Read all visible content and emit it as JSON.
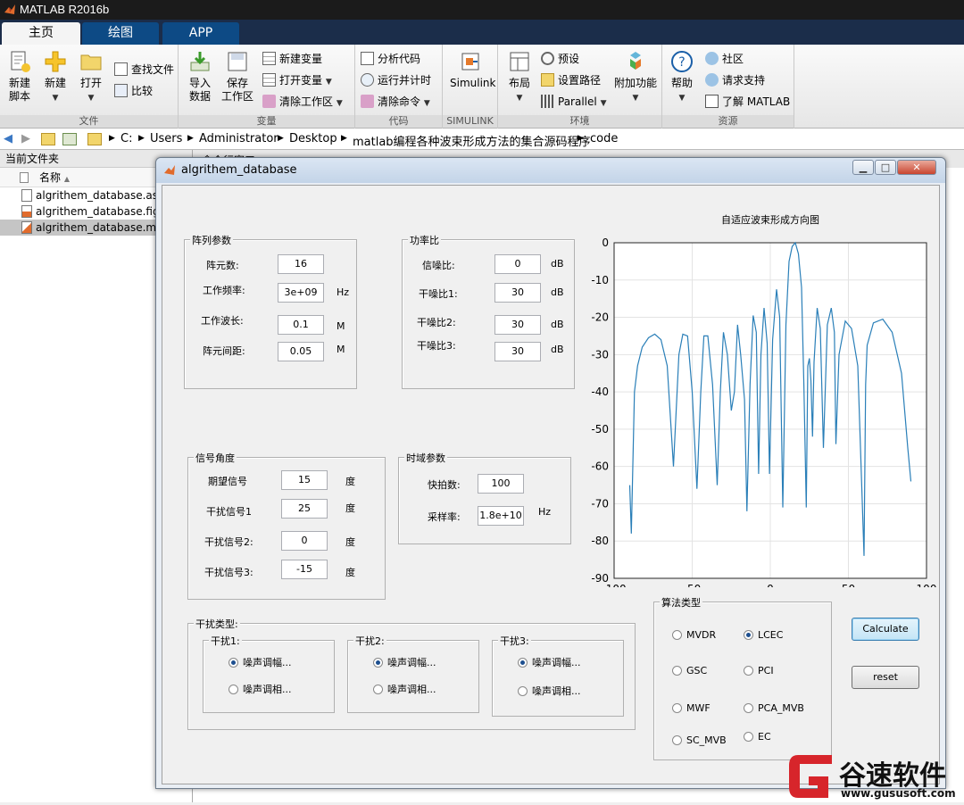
{
  "app": {
    "title": "MATLAB R2016b"
  },
  "tabs": [
    {
      "label": "主页"
    },
    {
      "label": "绘图"
    },
    {
      "label": "APP"
    }
  ],
  "ribbon": {
    "file": {
      "caption": "文件",
      "new_script": "新建\n脚本",
      "new": "新建",
      "open": "打开",
      "find_files": "查找文件",
      "compare": "比较"
    },
    "variable": {
      "caption": "变量",
      "import": "导入\n数据",
      "save_ws": "保存\n工作区",
      "new_var": "新建变量",
      "open_var": "打开变量",
      "clear_ws": "清除工作区"
    },
    "code": {
      "caption": "代码",
      "analyze": "分析代码",
      "run_time": "运行并计时",
      "clear_cmd": "清除命令"
    },
    "simulink": {
      "caption": "SIMULINK",
      "label": "Simulink"
    },
    "env": {
      "caption": "环境",
      "layout": "布局",
      "prefs": "预设",
      "set_path": "设置路径",
      "parallel": "Parallel",
      "addons": "附加功能"
    },
    "resources": {
      "caption": "资源",
      "help": "帮助",
      "community": "社区",
      "support": "请求支持",
      "learn": "了解 MATLAB"
    }
  },
  "address": {
    "parts": [
      "C:",
      "Users",
      "Administrator",
      "Desktop",
      "matlab编程各种波束形成方法的集合源码程序",
      "code"
    ]
  },
  "current_folder": {
    "title": "当前文件夹",
    "column": "名称",
    "files": [
      "algrithem_database.asv",
      "algrithem_database.fig",
      "algrithem_database.m"
    ]
  },
  "command_window": {
    "title": "命令行窗口"
  },
  "figure": {
    "title": "algrithem_database",
    "array_panel": {
      "title": "阵列参数",
      "rows": [
        {
          "label": "阵元数:",
          "value": "16",
          "unit": ""
        },
        {
          "label": "工作频率:",
          "value": "3e+09",
          "unit": "Hz"
        },
        {
          "label": "工作波长:",
          "value": "0.1",
          "unit": "M"
        },
        {
          "label": "阵元间距:",
          "value": "0.05",
          "unit": "M"
        }
      ]
    },
    "power_panel": {
      "title": "功率比",
      "rows": [
        {
          "label": "信噪比:",
          "value": "0",
          "unit": "dB"
        },
        {
          "label": "干噪比1:",
          "value": "30",
          "unit": "dB"
        },
        {
          "label": "干噪比2:",
          "value": "30",
          "unit": "dB"
        },
        {
          "label": "干噪比3:",
          "value": "30",
          "unit": "dB"
        }
      ]
    },
    "angle_panel": {
      "title": "信号角度",
      "rows": [
        {
          "label": "期望信号",
          "value": "15",
          "unit": "度"
        },
        {
          "label": "干扰信号1",
          "value": "25",
          "unit": "度"
        },
        {
          "label": "干扰信号2:",
          "value": "0",
          "unit": "度"
        },
        {
          "label": "干扰信号3:",
          "value": "-15",
          "unit": "度"
        }
      ]
    },
    "time_panel": {
      "title": "时域参数",
      "rows": [
        {
          "label": "快拍数:",
          "value": "100",
          "unit": ""
        },
        {
          "label": "采样率:",
          "value": "1.8e+10",
          "unit": "Hz"
        }
      ]
    },
    "interference": {
      "title": "干扰类型:",
      "groups": [
        {
          "title": "干扰1:",
          "opt1": "噪声调幅...",
          "opt2": "噪声调相..."
        },
        {
          "title": "干扰2:",
          "opt1": "噪声调幅...",
          "opt2": "噪声调相..."
        },
        {
          "title": "干扰3:",
          "opt1": "噪声调幅...",
          "opt2": "噪声调相..."
        }
      ]
    },
    "algorithm": {
      "title": "算法类型",
      "options": [
        "MVDR",
        "LCEC",
        "GSC",
        "PCI",
        "MWF",
        "PCA_MVB",
        "SC_MVB",
        "EC"
      ],
      "selected": "LCEC"
    },
    "buttons": {
      "calculate": "Calculate",
      "reset": "reset"
    }
  },
  "chart_data": {
    "type": "line",
    "title": "自适应波束形成方向图",
    "xlabel": "",
    "ylabel": "",
    "xlim": [
      -100,
      100
    ],
    "ylim": [
      -90,
      0
    ],
    "xticks": [
      -100,
      -50,
      0,
      50,
      100
    ],
    "yticks": [
      0,
      -10,
      -20,
      -30,
      -40,
      -50,
      -60,
      -70,
      -80,
      -90
    ],
    "grid": true,
    "color": "#2a7fb8",
    "series": [
      {
        "x": [
          -90,
          -89,
          -87,
          -85,
          -82,
          -78,
          -74,
          -70,
          -66,
          -62,
          -58.5,
          -56,
          -53,
          -50,
          -47,
          -44.5,
          -42.5,
          -40,
          -37,
          -34,
          -32,
          -30,
          -27.5,
          -25,
          -23,
          -21,
          -19,
          -16.5,
          -15,
          -13,
          -11,
          -9,
          -7.5,
          -6,
          -4,
          -2,
          -0.5,
          1.5,
          4,
          6,
          8,
          10,
          12,
          14,
          16,
          18,
          20,
          21.5,
          23,
          24,
          25,
          26,
          27,
          28,
          30,
          32,
          34,
          36.5,
          39,
          41,
          42,
          44,
          48,
          52,
          56,
          60,
          61,
          62,
          66,
          72,
          78,
          84,
          88,
          90
        ],
        "y": [
          -65,
          -78,
          -40,
          -33,
          -28,
          -25.5,
          -24.5,
          -26,
          -33,
          -60,
          -30,
          -24.5,
          -25,
          -40,
          -66,
          -40,
          -25,
          -25,
          -38,
          -65,
          -40,
          -24,
          -30,
          -45,
          -40,
          -22,
          -30,
          -42,
          -72,
          -38,
          -19.5,
          -24,
          -62,
          -30,
          -17.5,
          -27,
          -62,
          -26,
          -12.5,
          -20,
          -71,
          -22,
          -5,
          -1,
          0,
          -3,
          -12,
          -38,
          -71,
          -33,
          -31,
          -37,
          -52,
          -32,
          -17.5,
          -23,
          -55,
          -22,
          -17.5,
          -24,
          -54,
          -30,
          -21,
          -23,
          -33,
          -84,
          -38,
          -27.5,
          -21.5,
          -20.5,
          -24,
          -35,
          -55,
          -64
        ]
      }
    ]
  },
  "watermark": {
    "brand": "谷速软件",
    "url": "www.gususoft.com"
  }
}
